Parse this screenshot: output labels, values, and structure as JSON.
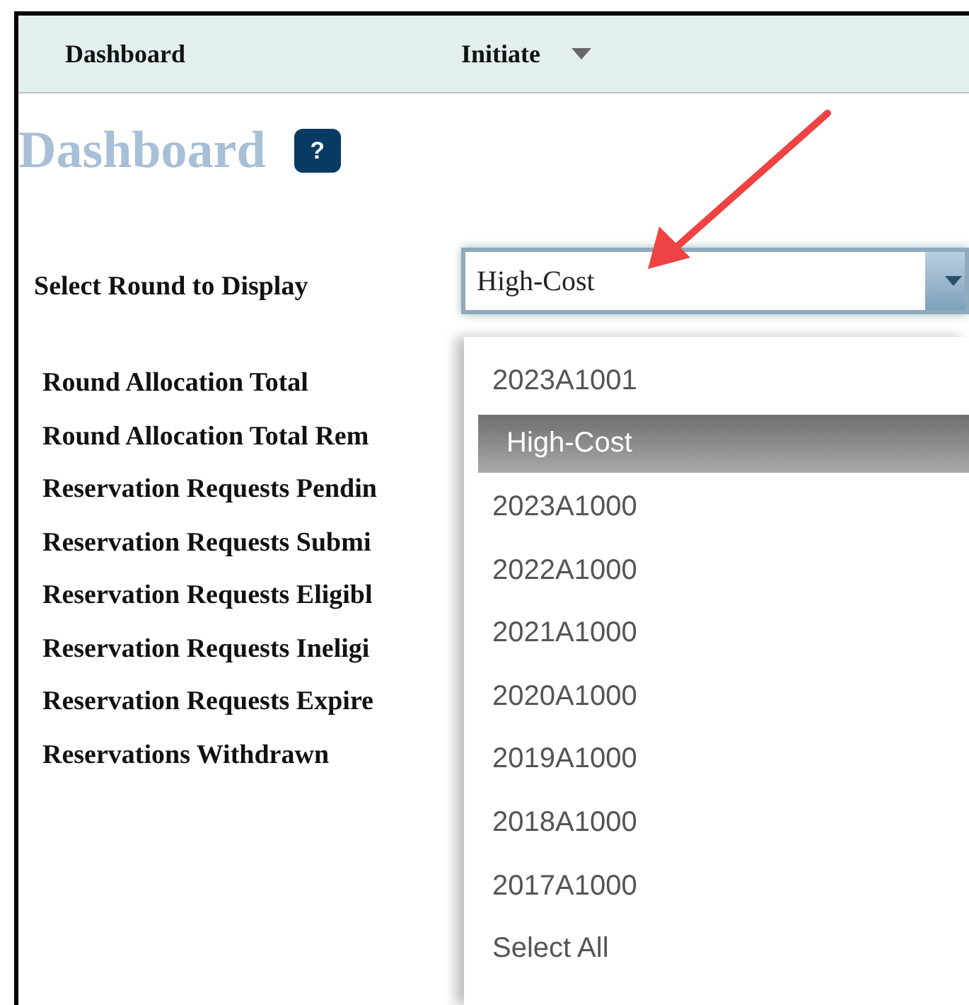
{
  "nav": [
    {
      "label": "Dashboard",
      "has_menu": false
    },
    {
      "label": "Initiate",
      "has_menu": true
    }
  ],
  "page_title": "Dashboard",
  "help_label": "?",
  "round_select": {
    "label": "Select Round to Display",
    "value": "High-Cost",
    "expanded": true,
    "options": [
      {
        "label": "2023A1001",
        "selected": false
      },
      {
        "label": "High-Cost",
        "selected": true
      },
      {
        "label": "2023A1000",
        "selected": false
      },
      {
        "label": "2022A1000",
        "selected": false
      },
      {
        "label": "2021A1000",
        "selected": false
      },
      {
        "label": "2020A1000",
        "selected": false
      },
      {
        "label": "2019A1000",
        "selected": false
      },
      {
        "label": "2018A1000",
        "selected": false
      },
      {
        "label": "2017A1000",
        "selected": false
      },
      {
        "label": "Select All",
        "selected": false
      }
    ]
  },
  "stats": [
    "Round Allocation Total",
    "Round Allocation Total Rem",
    "Reservation Requests Pendin",
    "Reservation Requests Submi",
    "Reservation Requests Eligibl",
    "Reservation Requests Ineligi",
    "Reservation Requests Expire",
    "Reservations Withdrawn"
  ]
}
